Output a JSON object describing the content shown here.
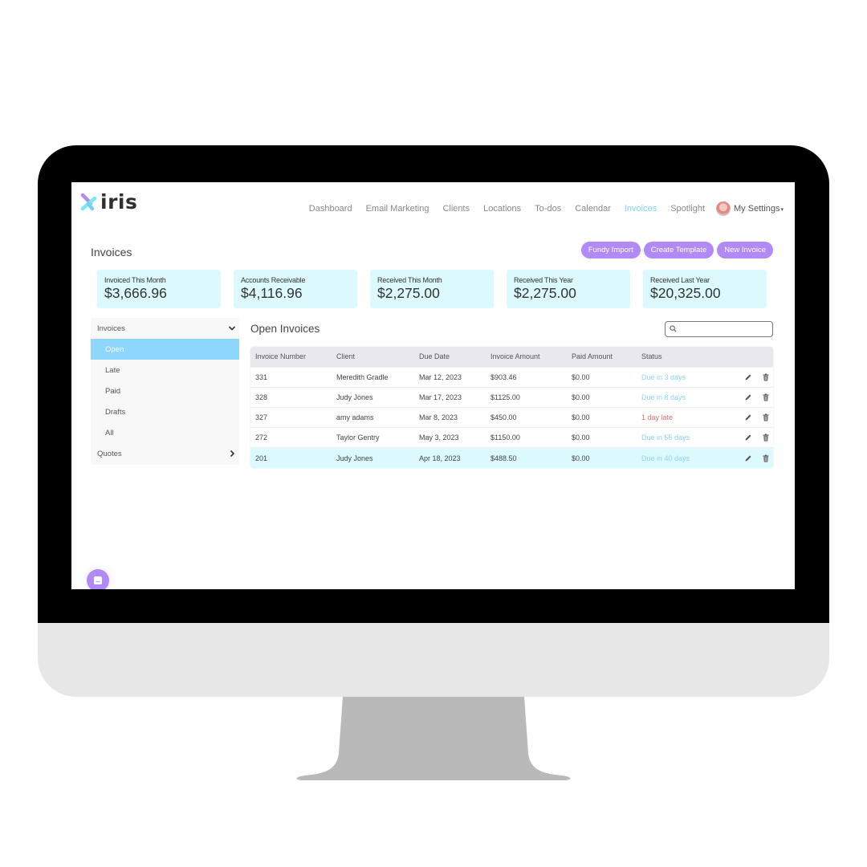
{
  "app": {
    "logo_text": "iris",
    "brand_colors": {
      "accent_purple": "#b18af7",
      "accent_blue": "#8ed6fb",
      "card_bg": "#dcf9fd",
      "late_red": "#e4706c"
    }
  },
  "nav": {
    "items": [
      {
        "label": "Dashboard",
        "active": false
      },
      {
        "label": "Email Marketing",
        "active": false
      },
      {
        "label": "Clients",
        "active": false
      },
      {
        "label": "Locations",
        "active": false
      },
      {
        "label": "To-dos",
        "active": false
      },
      {
        "label": "Calendar",
        "active": false
      },
      {
        "label": "Invoices",
        "active": true
      },
      {
        "label": "Spotlight",
        "active": false
      }
    ],
    "settings_label": "My Settings",
    "settings_caret": "▾"
  },
  "page": {
    "title": "Invoices",
    "buttons": {
      "fundy_import": "Fundy Import",
      "create_template": "Create Template",
      "new_invoice": "New Invoice"
    }
  },
  "stats": [
    {
      "label": "Invoiced This Month",
      "value": "$3,666.96"
    },
    {
      "label": "Accounts Receivable",
      "value": "$4,116.96"
    },
    {
      "label": "Received This Month",
      "value": "$2,275.00"
    },
    {
      "label": "Received This Year",
      "value": "$2,275.00"
    },
    {
      "label": "Received Last Year",
      "value": "$20,325.00"
    }
  ],
  "sidebar": {
    "invoices_label": "Invoices",
    "invoices_chevron": "⌄",
    "items": [
      {
        "label": "Open",
        "active": true
      },
      {
        "label": "Late",
        "active": false
      },
      {
        "label": "Paid",
        "active": false
      },
      {
        "label": "Drafts",
        "active": false
      },
      {
        "label": "All",
        "active": false
      }
    ],
    "quotes_label": "Quotes",
    "quotes_chevron": "›"
  },
  "main": {
    "title": "Open Invoices",
    "search": {
      "placeholder": "",
      "value": ""
    },
    "table": {
      "columns": [
        "Invoice Number",
        "Client",
        "Due Date",
        "Invoice Amount",
        "Paid Amount",
        "Status"
      ],
      "rows": [
        {
          "number": "331",
          "client": "Meredith Gradle",
          "due": "Mar 12, 2023",
          "amount": "$903.46",
          "paid": "$0.00",
          "status": "Due in 3 days",
          "status_type": "due",
          "highlight": false
        },
        {
          "number": "328",
          "client": "Judy Jones",
          "due": "Mar 17, 2023",
          "amount": "$1125.00",
          "paid": "$0.00",
          "status": "Due in 8 days",
          "status_type": "due",
          "highlight": false
        },
        {
          "number": "327",
          "client": "amy adams",
          "due": "Mar 8, 2023",
          "amount": "$450.00",
          "paid": "$0.00",
          "status": "1 day late",
          "status_type": "late",
          "highlight": false
        },
        {
          "number": "272",
          "client": "Taylor Gentry",
          "due": "May 3, 2023",
          "amount": "$1150.00",
          "paid": "$0.00",
          "status": "Due in 55 days",
          "status_type": "due",
          "highlight": false
        },
        {
          "number": "201",
          "client": "Judy Jones",
          "due": "Apr 18, 2023",
          "amount": "$488.50",
          "paid": "$0.00",
          "status": "Due in 40 days",
          "status_type": "due",
          "highlight": true
        }
      ]
    }
  }
}
